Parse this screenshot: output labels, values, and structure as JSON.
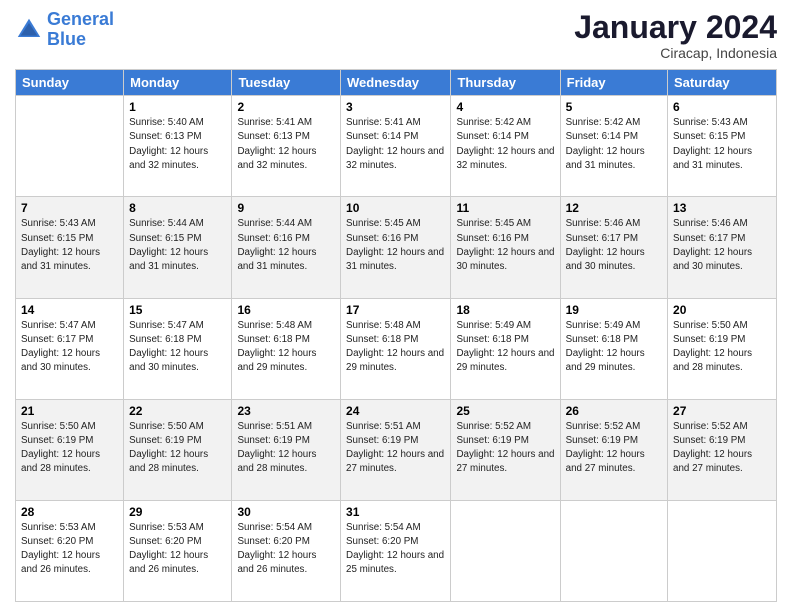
{
  "header": {
    "logo_line1": "General",
    "logo_line2": "Blue",
    "main_title": "January 2024",
    "subtitle": "Ciracap, Indonesia"
  },
  "days_of_week": [
    "Sunday",
    "Monday",
    "Tuesday",
    "Wednesday",
    "Thursday",
    "Friday",
    "Saturday"
  ],
  "weeks": [
    [
      {
        "day": "",
        "sunrise": "",
        "sunset": "",
        "daylight": "",
        "empty": true
      },
      {
        "day": "1",
        "sunrise": "Sunrise: 5:40 AM",
        "sunset": "Sunset: 6:13 PM",
        "daylight": "Daylight: 12 hours and 32 minutes."
      },
      {
        "day": "2",
        "sunrise": "Sunrise: 5:41 AM",
        "sunset": "Sunset: 6:13 PM",
        "daylight": "Daylight: 12 hours and 32 minutes."
      },
      {
        "day": "3",
        "sunrise": "Sunrise: 5:41 AM",
        "sunset": "Sunset: 6:14 PM",
        "daylight": "Daylight: 12 hours and 32 minutes."
      },
      {
        "day": "4",
        "sunrise": "Sunrise: 5:42 AM",
        "sunset": "Sunset: 6:14 PM",
        "daylight": "Daylight: 12 hours and 32 minutes."
      },
      {
        "day": "5",
        "sunrise": "Sunrise: 5:42 AM",
        "sunset": "Sunset: 6:14 PM",
        "daylight": "Daylight: 12 hours and 31 minutes."
      },
      {
        "day": "6",
        "sunrise": "Sunrise: 5:43 AM",
        "sunset": "Sunset: 6:15 PM",
        "daylight": "Daylight: 12 hours and 31 minutes."
      }
    ],
    [
      {
        "day": "7",
        "sunrise": "Sunrise: 5:43 AM",
        "sunset": "Sunset: 6:15 PM",
        "daylight": "Daylight: 12 hours and 31 minutes."
      },
      {
        "day": "8",
        "sunrise": "Sunrise: 5:44 AM",
        "sunset": "Sunset: 6:15 PM",
        "daylight": "Daylight: 12 hours and 31 minutes."
      },
      {
        "day": "9",
        "sunrise": "Sunrise: 5:44 AM",
        "sunset": "Sunset: 6:16 PM",
        "daylight": "Daylight: 12 hours and 31 minutes."
      },
      {
        "day": "10",
        "sunrise": "Sunrise: 5:45 AM",
        "sunset": "Sunset: 6:16 PM",
        "daylight": "Daylight: 12 hours and 31 minutes."
      },
      {
        "day": "11",
        "sunrise": "Sunrise: 5:45 AM",
        "sunset": "Sunset: 6:16 PM",
        "daylight": "Daylight: 12 hours and 30 minutes."
      },
      {
        "day": "12",
        "sunrise": "Sunrise: 5:46 AM",
        "sunset": "Sunset: 6:17 PM",
        "daylight": "Daylight: 12 hours and 30 minutes."
      },
      {
        "day": "13",
        "sunrise": "Sunrise: 5:46 AM",
        "sunset": "Sunset: 6:17 PM",
        "daylight": "Daylight: 12 hours and 30 minutes."
      }
    ],
    [
      {
        "day": "14",
        "sunrise": "Sunrise: 5:47 AM",
        "sunset": "Sunset: 6:17 PM",
        "daylight": "Daylight: 12 hours and 30 minutes."
      },
      {
        "day": "15",
        "sunrise": "Sunrise: 5:47 AM",
        "sunset": "Sunset: 6:18 PM",
        "daylight": "Daylight: 12 hours and 30 minutes."
      },
      {
        "day": "16",
        "sunrise": "Sunrise: 5:48 AM",
        "sunset": "Sunset: 6:18 PM",
        "daylight": "Daylight: 12 hours and 29 minutes."
      },
      {
        "day": "17",
        "sunrise": "Sunrise: 5:48 AM",
        "sunset": "Sunset: 6:18 PM",
        "daylight": "Daylight: 12 hours and 29 minutes."
      },
      {
        "day": "18",
        "sunrise": "Sunrise: 5:49 AM",
        "sunset": "Sunset: 6:18 PM",
        "daylight": "Daylight: 12 hours and 29 minutes."
      },
      {
        "day": "19",
        "sunrise": "Sunrise: 5:49 AM",
        "sunset": "Sunset: 6:18 PM",
        "daylight": "Daylight: 12 hours and 29 minutes."
      },
      {
        "day": "20",
        "sunrise": "Sunrise: 5:50 AM",
        "sunset": "Sunset: 6:19 PM",
        "daylight": "Daylight: 12 hours and 28 minutes."
      }
    ],
    [
      {
        "day": "21",
        "sunrise": "Sunrise: 5:50 AM",
        "sunset": "Sunset: 6:19 PM",
        "daylight": "Daylight: 12 hours and 28 minutes."
      },
      {
        "day": "22",
        "sunrise": "Sunrise: 5:50 AM",
        "sunset": "Sunset: 6:19 PM",
        "daylight": "Daylight: 12 hours and 28 minutes."
      },
      {
        "day": "23",
        "sunrise": "Sunrise: 5:51 AM",
        "sunset": "Sunset: 6:19 PM",
        "daylight": "Daylight: 12 hours and 28 minutes."
      },
      {
        "day": "24",
        "sunrise": "Sunrise: 5:51 AM",
        "sunset": "Sunset: 6:19 PM",
        "daylight": "Daylight: 12 hours and 27 minutes."
      },
      {
        "day": "25",
        "sunrise": "Sunrise: 5:52 AM",
        "sunset": "Sunset: 6:19 PM",
        "daylight": "Daylight: 12 hours and 27 minutes."
      },
      {
        "day": "26",
        "sunrise": "Sunrise: 5:52 AM",
        "sunset": "Sunset: 6:19 PM",
        "daylight": "Daylight: 12 hours and 27 minutes."
      },
      {
        "day": "27",
        "sunrise": "Sunrise: 5:52 AM",
        "sunset": "Sunset: 6:19 PM",
        "daylight": "Daylight: 12 hours and 27 minutes."
      }
    ],
    [
      {
        "day": "28",
        "sunrise": "Sunrise: 5:53 AM",
        "sunset": "Sunset: 6:20 PM",
        "daylight": "Daylight: 12 hours and 26 minutes."
      },
      {
        "day": "29",
        "sunrise": "Sunrise: 5:53 AM",
        "sunset": "Sunset: 6:20 PM",
        "daylight": "Daylight: 12 hours and 26 minutes."
      },
      {
        "day": "30",
        "sunrise": "Sunrise: 5:54 AM",
        "sunset": "Sunset: 6:20 PM",
        "daylight": "Daylight: 12 hours and 26 minutes."
      },
      {
        "day": "31",
        "sunrise": "Sunrise: 5:54 AM",
        "sunset": "Sunset: 6:20 PM",
        "daylight": "Daylight: 12 hours and 25 minutes."
      },
      {
        "day": "",
        "sunrise": "",
        "sunset": "",
        "daylight": "",
        "empty": true
      },
      {
        "day": "",
        "sunrise": "",
        "sunset": "",
        "daylight": "",
        "empty": true
      },
      {
        "day": "",
        "sunrise": "",
        "sunset": "",
        "daylight": "",
        "empty": true
      }
    ]
  ]
}
